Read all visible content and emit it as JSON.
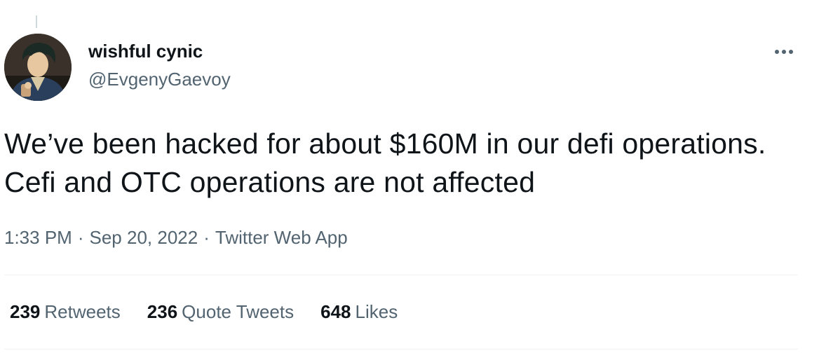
{
  "tweet": {
    "author": {
      "display_name": "wishful cynic",
      "handle": "@EvgenyGaevoy"
    },
    "text": "We’ve been hacked for about $160M in our defi operations. Cefi and OTC operations are not affected",
    "time": "1:33 PM",
    "separator": "·",
    "date": "Sep 20, 2022",
    "source": "Twitter Web App",
    "stats": [
      {
        "count": "239",
        "label": "Retweets"
      },
      {
        "count": "236",
        "label": "Quote Tweets"
      },
      {
        "count": "648",
        "label": "Likes"
      }
    ],
    "more_icon": "more-horizontal-icon"
  },
  "colors": {
    "text_primary": "#0f1419",
    "text_secondary": "#536471",
    "divider": "#eff3f4"
  }
}
